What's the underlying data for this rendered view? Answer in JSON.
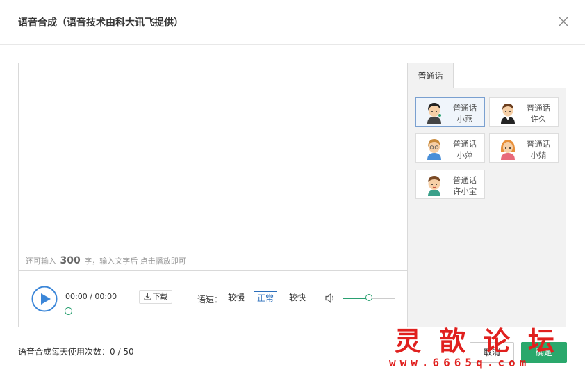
{
  "dialog": {
    "title": "语音合成（语音技术由科大讯飞提供）"
  },
  "editor": {
    "hint_prefix": "还可输入",
    "remaining": "300",
    "hint_suffix": "字，输入文字后 点击播放即可"
  },
  "player": {
    "time": "00:00 / 00:00",
    "download_label": "下载",
    "speed_label": "语速：",
    "speeds": [
      "较慢",
      "正常",
      "较快"
    ],
    "selected_speed": "正常",
    "volume_level": 0.5
  },
  "voice_tabs": [
    "普通话"
  ],
  "voices": [
    {
      "lang": "普通话",
      "name": "小燕",
      "selected": true
    },
    {
      "lang": "普通话",
      "name": "许久",
      "selected": false
    },
    {
      "lang": "普通话",
      "name": "小萍",
      "selected": false
    },
    {
      "lang": "普通话",
      "name": "小婧",
      "selected": false
    },
    {
      "lang": "普通话",
      "name": "许小宝",
      "selected": false
    }
  ],
  "footer": {
    "usage_label": "语音合成每天使用次数：",
    "usage_value": "0 / 50",
    "cancel_label": "取消",
    "ok_label": "确定"
  },
  "watermark": {
    "title": "灵歆论坛",
    "url": "www.6665q.com"
  },
  "colors": {
    "accent_green": "#2aa86c",
    "selected_blue": "#2a6ebb",
    "watermark_red": "#e0201e"
  }
}
